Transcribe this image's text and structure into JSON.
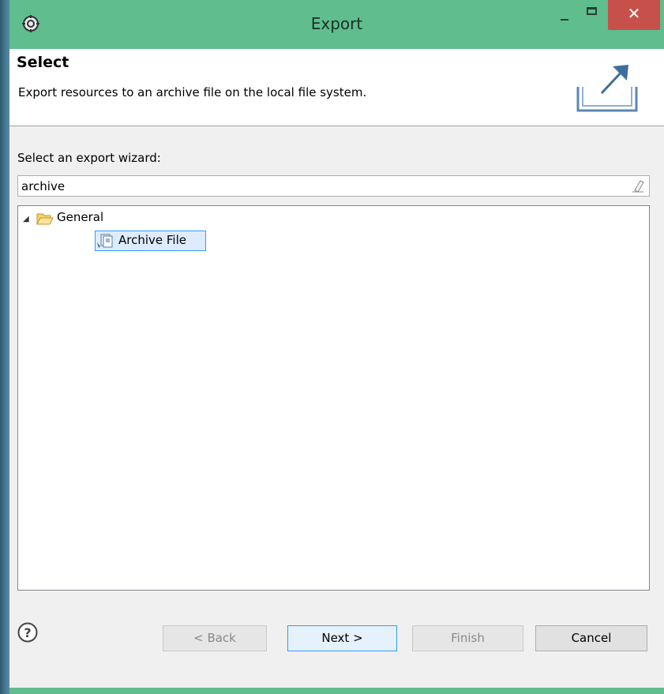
{
  "window": {
    "title": "Export"
  },
  "title_bar": {
    "close_glyph": "✕"
  },
  "banner": {
    "title": "Select",
    "description": "Export resources to an archive file on the local file system.",
    "icon": "export-icon"
  },
  "wizard": {
    "label": "Select an export wizard:",
    "filter_value": "archive"
  },
  "tree": {
    "group_label": "General",
    "item_label": "Archive File"
  },
  "buttons": {
    "back": "< Back",
    "next": "Next >",
    "finish": "Finish",
    "cancel": "Cancel"
  },
  "colors": {
    "title_bar": "#5fbd8e",
    "close_button": "#c7504b",
    "selection_border": "#3399ff"
  }
}
